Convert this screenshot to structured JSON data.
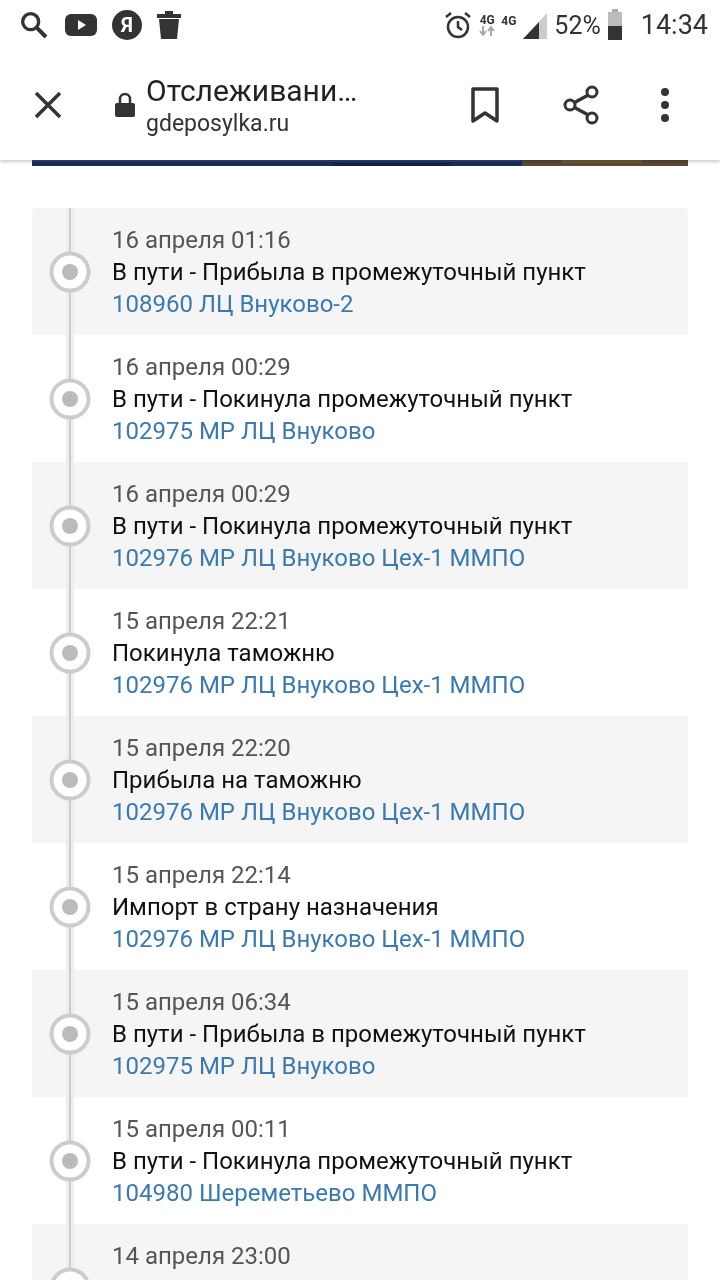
{
  "status_bar": {
    "app_badge": "Я",
    "network_1": "4G",
    "network_2": "4G",
    "battery": "52%",
    "time": "14:34"
  },
  "toolbar": {
    "title": "Отслеживани…",
    "url": "gdeposylka.ru"
  },
  "events": [
    {
      "date": "16 апреля 01:16",
      "status": "В пути - Прибыла в промежуточный пункт",
      "place": "108960 ЛЦ Внуково-2"
    },
    {
      "date": "16 апреля 00:29",
      "status": "В пути - Покинула промежуточный пункт",
      "place": "102975 МР ЛЦ Внуково"
    },
    {
      "date": "16 апреля 00:29",
      "status": "В пути - Покинула промежуточный пункт",
      "place": "102976 МР ЛЦ Внуково Цех-1 ММПО"
    },
    {
      "date": "15 апреля 22:21",
      "status": "Покинула таможню",
      "place": "102976 МР ЛЦ Внуково Цех-1 ММПО"
    },
    {
      "date": "15 апреля 22:20",
      "status": "Прибыла на таможню",
      "place": "102976 МР ЛЦ Внуково Цех-1 ММПО"
    },
    {
      "date": "15 апреля 22:14",
      "status": "Импорт в страну назначения",
      "place": "102976 МР ЛЦ Внуково Цех-1 ММПО"
    },
    {
      "date": "15 апреля 06:34",
      "status": "В пути - Прибыла в промежуточный пункт",
      "place": "102975 МР ЛЦ Внуково"
    },
    {
      "date": "15 апреля 00:11",
      "status": "В пути - Покинула промежуточный пункт",
      "place": "104980 Шереметьево ММПО"
    },
    {
      "date": "14 апреля 23:00"
    }
  ]
}
